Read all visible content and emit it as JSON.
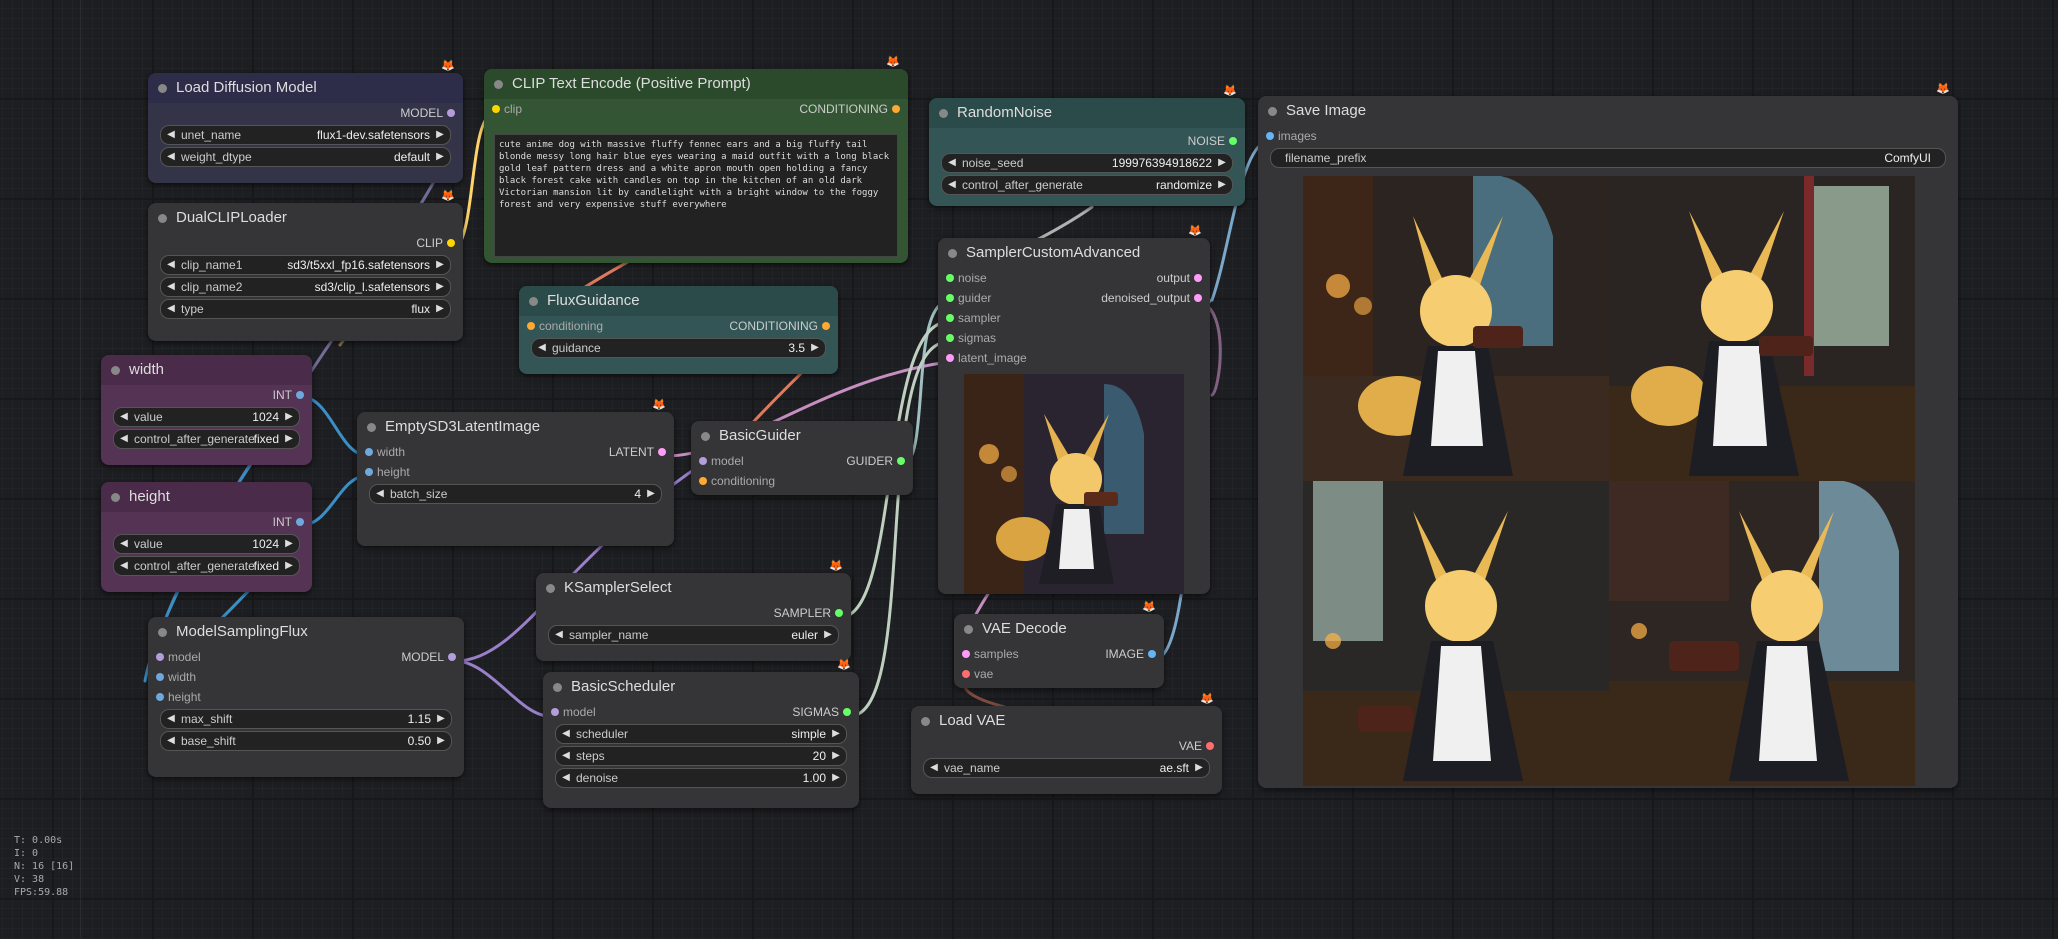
{
  "colors": {
    "model": "#b39ddb",
    "clip": "#ffd500",
    "conditioning": "#ffa931",
    "int": "#6fa8dc",
    "latent": "#ff9cf9",
    "noise": "#b0b0b0",
    "guider": "#66ffff",
    "sampler": "#ecb4b4",
    "sigmas": "#cdffcd",
    "vae": "#ff6e6e",
    "image": "#64b5f6"
  },
  "nodes": {
    "load_diffusion": {
      "title": "Load Diffusion Model",
      "out": "MODEL",
      "w_unet_name": "unet_name",
      "v_unet_name": "flux1-dev.safetensors",
      "w_weight_dtype": "weight_dtype",
      "v_weight_dtype": "default"
    },
    "dual_clip": {
      "title": "DualCLIPLoader",
      "out": "CLIP",
      "w_clip1": "clip_name1",
      "v_clip1": "sd3/t5xxl_fp16.safetensors",
      "w_clip2": "clip_name2",
      "v_clip2": "sd3/clip_l.safetensors",
      "w_type": "type",
      "v_type": "flux"
    },
    "clip_text": {
      "title": "CLIP Text Encode (Positive Prompt)",
      "in": "clip",
      "out": "CONDITIONING",
      "text": "cute anime dog with massive fluffy fennec ears and a big fluffy tail blonde messy long hair blue eyes wearing a maid outfit with a long black gold leaf pattern dress and a white apron mouth open holding a fancy black forest cake with candles on top in the kitchen of an old dark Victorian mansion lit by candlelight with a bright window to the foggy forest and very expensive stuff everywhere"
    },
    "width": {
      "title": "width",
      "out": "INT",
      "w_value": "value",
      "v_value": "1024",
      "w_cag": "control_after_generate",
      "v_cag": "fixed"
    },
    "height": {
      "title": "height",
      "out": "INT",
      "w_value": "value",
      "v_value": "1024",
      "w_cag": "control_after_generate",
      "v_cag": "fixed"
    },
    "flux_guidance": {
      "title": "FluxGuidance",
      "in": "conditioning",
      "out": "CONDITIONING",
      "w_guidance": "guidance",
      "v_guidance": "3.5"
    },
    "empty_latent": {
      "title": "EmptySD3LatentImage",
      "in_width": "width",
      "in_height": "height",
      "out": "LATENT",
      "w_batch": "batch_size",
      "v_batch": "4"
    },
    "basic_guider": {
      "title": "BasicGuider",
      "in_model": "model",
      "in_cond": "conditioning",
      "out": "GUIDER"
    },
    "ksampler_select": {
      "title": "KSamplerSelect",
      "out": "SAMPLER",
      "w_sampler": "sampler_name",
      "v_sampler": "euler"
    },
    "model_sampling": {
      "title": "ModelSamplingFlux",
      "in_model": "model",
      "in_width": "width",
      "in_height": "height",
      "out": "MODEL",
      "w_max": "max_shift",
      "v_max": "1.15",
      "w_base": "base_shift",
      "v_base": "0.50"
    },
    "basic_scheduler": {
      "title": "BasicScheduler",
      "in_model": "model",
      "out": "SIGMAS",
      "w_sched": "scheduler",
      "v_sched": "simple",
      "w_steps": "steps",
      "v_steps": "20",
      "w_denoise": "denoise",
      "v_denoise": "1.00"
    },
    "random_noise": {
      "title": "RandomNoise",
      "out": "NOISE",
      "w_seed": "noise_seed",
      "v_seed": "199976394918622",
      "w_cag": "control_after_generate",
      "v_cag": "randomize"
    },
    "sampler_custom": {
      "title": "SamplerCustomAdvanced",
      "in_noise": "noise",
      "in_guider": "guider",
      "in_sampler": "sampler",
      "in_sigmas": "sigmas",
      "in_latent": "latent_image",
      "out_output": "output",
      "out_denoised": "denoised_output"
    },
    "vae_decode": {
      "title": "VAE Decode",
      "in_samples": "samples",
      "in_vae": "vae",
      "out": "IMAGE"
    },
    "load_vae": {
      "title": "Load VAE",
      "out": "VAE",
      "w_vae": "vae_name",
      "v_vae": "ae.sft"
    },
    "save_image": {
      "title": "Save Image",
      "in": "images",
      "w_prefix": "filename_prefix",
      "v_prefix": "ComfyUI"
    }
  },
  "stats": {
    "t": "T: 0.00s",
    "i": "I: 0",
    "n": "N: 16 [16]",
    "v": "V: 38",
    "fps": "FPS:59.88"
  }
}
